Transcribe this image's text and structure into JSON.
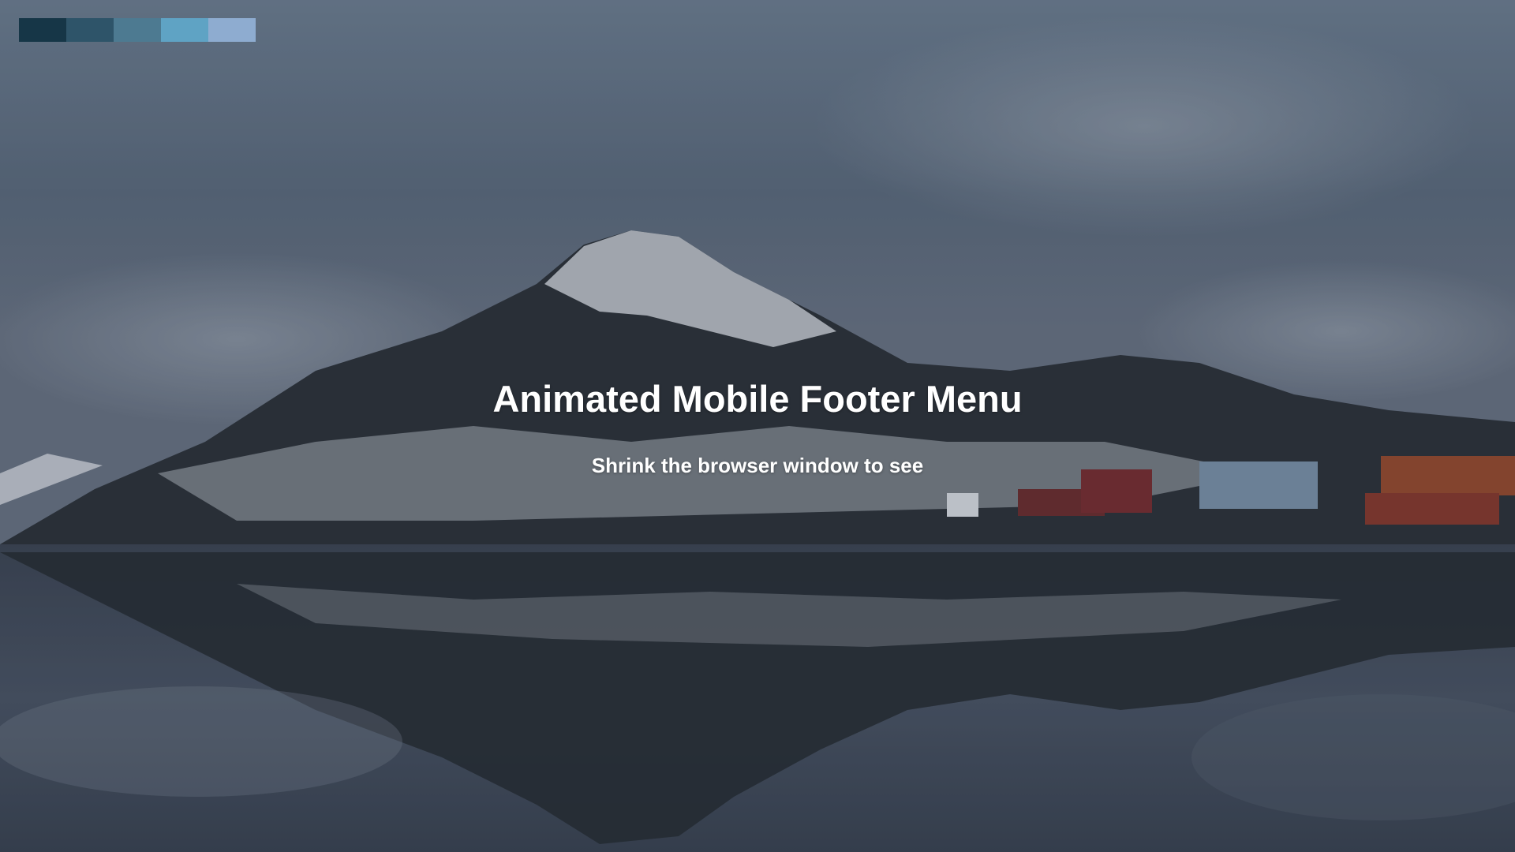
{
  "hero": {
    "title": "Animated Mobile Footer Menu",
    "subtitle": "Shrink the browser window to see"
  },
  "palette": {
    "swatches": [
      "#163647",
      "#2e5469",
      "#4d7a91",
      "#5fa3c4",
      "#8eacd0"
    ]
  },
  "background": {
    "scene": "snowy-mountain-lake-reflection-photo"
  }
}
